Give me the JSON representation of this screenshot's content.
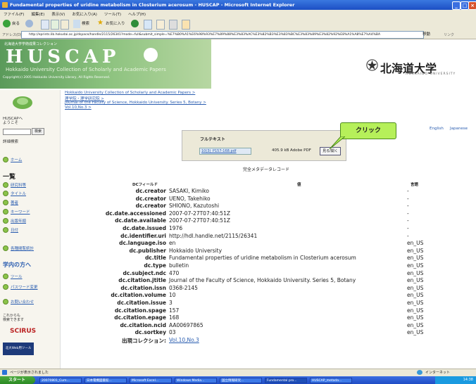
{
  "window": {
    "title": "Fundamental properties of uridine metabolism in Closterium acerosum - HUSCAP - Microsoft Internet Explorer"
  },
  "menubar": [
    "ファイル(F)",
    "編集(E)",
    "表示(V)",
    "お気に入り(A)",
    "ツール(T)",
    "ヘルプ(H)"
  ],
  "toolbar": {
    "back": "戻る",
    "search": "検索",
    "favorites": "お気に入り"
  },
  "address": {
    "label": "アドレス(D)",
    "url": "http://eprints.lib.hokudai.ac.jp/dspace/handle/2115/26341?mode=full&submit_simple=%E7%B0%A1%E6%98%93%E7%89%88%E3%83%AC%E3%82%B3%E3%83%BC%E3%83%89%E3%82%92%E8%A1%A8%E7%A4%BA",
    "go": "移動",
    "links": "リンク"
  },
  "banner": {
    "collection_label": "北海道大学学術成果コレクション",
    "logo": "HUSCAP",
    "subtitle": "Hokkaido University Collection of Scholarly and Academic Papers",
    "copyright": "Copyright(c) 2005 Hokkaido University Library, All Rights Reserved.",
    "university": "北海道大学",
    "university_en": "HOKKAIDO UNIVERSITY"
  },
  "sidebar": {
    "welcome": "HUSCAPへ\nようこそ",
    "search_button": "検索",
    "advanced_search": "詳細検索",
    "home": "ホーム",
    "browse_head": "一覧",
    "browse_items": [
      "研究科等",
      "タイトル",
      "著者",
      "キーワード",
      "出版年順",
      "日付"
    ],
    "stats": "各種閲覧統計",
    "researchers_head": "学内の方へ",
    "researchers_items": [
      "ツール",
      "パスワード変更"
    ],
    "contact": "お問い合わせ",
    "searchable_text": "これからも\n検索できます",
    "scirus": "SCIRUS",
    "banner2": "北大Web用ツール"
  },
  "breadcrumbs": [
    "Hokkaido University Collection of Scholarly and Academic Papers >",
    "理学院・理学研究院 >",
    "Journal of the Faculty of Science, Hokkaido University. Series 5, Botany >",
    "Vol.10,No.3 >"
  ],
  "fulltext": {
    "label": "フルテキスト",
    "file": "10(3)_P157-168.pdf",
    "size": "405.9 kB",
    "format": "Adobe PDF",
    "view": "見る/開く",
    "callout": "クリック"
  },
  "lang": {
    "en": "English",
    "ja": "Japanese"
  },
  "metadata": {
    "title": "完全メタデータレコード",
    "headers": {
      "field": "DCフィールド",
      "value": "値",
      "lang": "言語"
    },
    "rows": [
      {
        "k": "dc.creator",
        "v": "SASAKI, Kimiko",
        "l": "-"
      },
      {
        "k": "dc.creator",
        "v": "UENO, Takehiko",
        "l": "-"
      },
      {
        "k": "dc.creator",
        "v": "SHIONO, Kazutoshi",
        "l": "-"
      },
      {
        "k": "dc.date.accessioned",
        "v": "2007-07-27T07:40:51Z",
        "l": "-"
      },
      {
        "k": "dc.date.available",
        "v": "2007-07-27T07:40:51Z",
        "l": "-"
      },
      {
        "k": "dc.date.issued",
        "v": "1976",
        "l": "-"
      },
      {
        "k": "dc.identifier.uri",
        "v": "http://hdl.handle.net/2115/26341",
        "l": "-"
      },
      {
        "k": "dc.language.iso",
        "v": "en",
        "l": "en_US"
      },
      {
        "k": "dc.publisher",
        "v": "Hokkaido University",
        "l": "en_US"
      },
      {
        "k": "dc.title",
        "v": "Fundamental properties of uridine metabolism in Closterium acerosum",
        "l": "en_US"
      },
      {
        "k": "dc.type",
        "v": "bulletin",
        "l": "en_US"
      },
      {
        "k": "dc.subject.ndc",
        "v": "470",
        "l": "en_US"
      },
      {
        "k": "dc.citation.jtitle",
        "v": "Journal of the Faculty of Science, Hokkaido University. Series 5, Botany",
        "l": "en_US"
      },
      {
        "k": "dc.citation.issn",
        "v": "0368-2145",
        "l": "en_US"
      },
      {
        "k": "dc.citation.volume",
        "v": "10",
        "l": "en_US"
      },
      {
        "k": "dc.citation.issue",
        "v": "3",
        "l": "en_US"
      },
      {
        "k": "dc.citation.spage",
        "v": "157",
        "l": "en_US"
      },
      {
        "k": "dc.citation.epage",
        "v": "168",
        "l": "en_US"
      },
      {
        "k": "dc.citation.ncid",
        "v": "AA00697865",
        "l": "en_US"
      },
      {
        "k": "dc.sortkey",
        "v": "03",
        "l": "en_US"
      },
      {
        "k": "出現コレクション:",
        "v": "Vol.10,No.3",
        "l": ""
      }
    ]
  },
  "status": {
    "text": "ページが表示されました",
    "zone": "インターネット"
  },
  "taskbar": {
    "start": "スタート",
    "tasks": [
      "20070801_Cum...",
      "日本電機図書館...",
      "Microsoft Excel...",
      "Windows Media...",
      "国立情報研究...",
      "Fundamental pro...",
      "HUSCAP_metada..."
    ],
    "clock": "14:38"
  },
  "colors": {
    "titlebar": "#1c4fc4",
    "accent_green": "#8cc27e",
    "link": "#2a5db0",
    "callout": "#b6f05a"
  }
}
